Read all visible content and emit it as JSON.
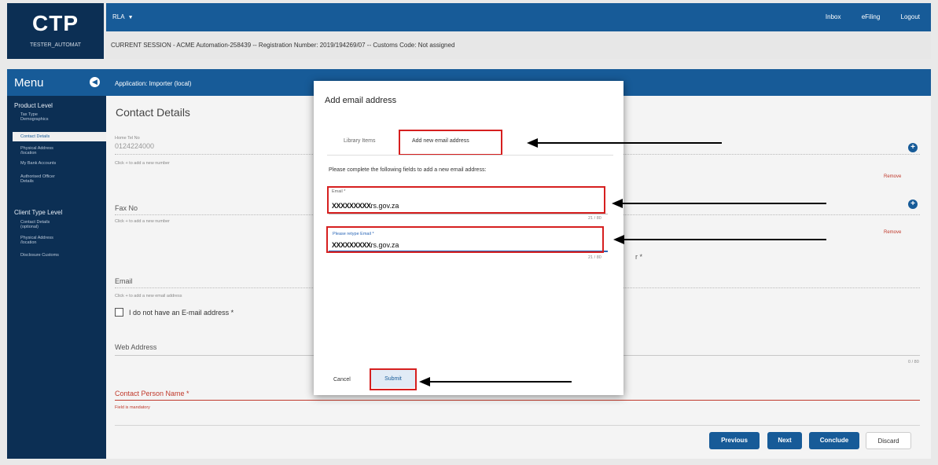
{
  "header": {
    "logo": "CTP",
    "username": "TESTER_AUTOMAT",
    "profile_menu": "RLA",
    "links": [
      "Inbox",
      "eFiling",
      "Logout"
    ],
    "session_text": "CURRENT SESSION - ACME Automation-258439 -- Registration Number: 2019/194269/07 -- Customs Code: Not assigned"
  },
  "sidebar": {
    "title": "Menu",
    "sections": [
      {
        "label": "Product Level",
        "items": [
          "Tax Type Demographics",
          "Contact Details",
          "Physical Address /location",
          "My Bank Accounts",
          "Authorised Officer Details"
        ]
      },
      {
        "label": "Client Type Level",
        "items": [
          "Contact Details (optional)",
          "Physical Address /location",
          "Disclosure Customs"
        ]
      }
    ]
  },
  "main": {
    "application": "Application: Importer (local)",
    "title": "Contact Details",
    "home_tel_label": "Home Tel No",
    "home_tel_value": "0124224000",
    "add_number_hint": "Click + to add a new number",
    "fax_label": "Fax No",
    "fax_hint": "Click + to add a new number",
    "email_label": "Email",
    "email_hint": "Click + to add a new email address",
    "no_email_label": "I do not have an E-mail address *",
    "web_label": "Web Address",
    "web_counter": "0 / 80",
    "contact_person_label": "Contact Person Name *",
    "mandatory_hint": "Field is mandatory",
    "remove_label": "Remove",
    "obscured_fragment": "r *",
    "buttons": {
      "previous": "Previous",
      "next": "Next",
      "conclude": "Conclude",
      "discard": "Discard"
    }
  },
  "modal": {
    "title": "Add email address",
    "tabs": [
      "Library Items",
      "Add new email address"
    ],
    "instruction": "Please complete the following fields to add a new email address:",
    "email_label": "Email *",
    "email_value_masked": "XXXXXXXXX",
    "email_value_suffix": "rs.gov.za",
    "email_counter": "21 / 80",
    "retype_label": "Please retype Email *",
    "retype_value_masked": "XXXXXXXXX",
    "retype_value_suffix": "rs.gov.za",
    "retype_counter": "21 / 80",
    "cancel": "Cancel",
    "submit": "Submit"
  },
  "colors": {
    "header_blue": "#175b98",
    "navy": "#0c2f54",
    "highlight_red": "#d61f1f",
    "remove_red": "#c0392b"
  }
}
